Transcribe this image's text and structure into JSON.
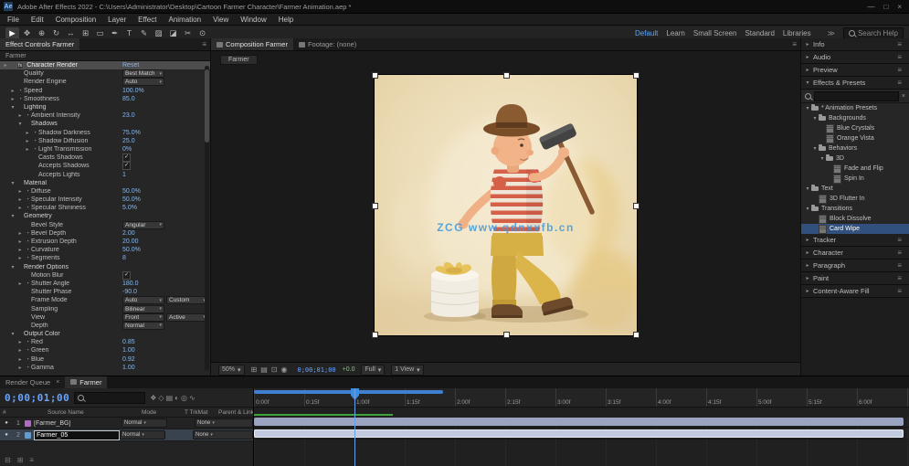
{
  "colors": {
    "accent_blue": "#5aa7ff",
    "value_blue": "#86b7ec",
    "timecode_blue": "#6aa3ff",
    "cache_green": "#3fa33c",
    "workarea_blue": "#3f80d0",
    "selection_blue": "#31507d",
    "panel_bg": "#262626",
    "viewer_bg": "#1a1a1a",
    "comp_background": "#ecdcb6",
    "watermark_blue": "#3f99dc"
  },
  "titlebar": {
    "app_badge": "Ae",
    "title": "Adobe After Effects 2022 - C:\\Users\\Administrator\\Desktop\\Cartoon Farmer Character\\Farmer Animation.aep *",
    "minimize": "—",
    "maximize": "□",
    "close": "×"
  },
  "menubar": {
    "items": [
      "File",
      "Edit",
      "Composition",
      "Layer",
      "Effect",
      "Animation",
      "View",
      "Window",
      "Help"
    ]
  },
  "toolbar": {
    "tools": [
      {
        "name": "selection-tool",
        "glyph": "▶"
      },
      {
        "name": "hand-tool",
        "glyph": "✥"
      },
      {
        "name": "zoom-tool",
        "glyph": "⊕"
      },
      {
        "name": "orbit-camera-tool",
        "glyph": "↻"
      },
      {
        "name": "pan-camera-tool",
        "glyph": "↔"
      },
      {
        "name": "pan-behind-tool",
        "glyph": "⊞"
      },
      {
        "name": "shape-tool",
        "glyph": "▭"
      },
      {
        "name": "pen-tool",
        "glyph": "✒"
      },
      {
        "name": "type-tool",
        "glyph": "T"
      },
      {
        "name": "brush-tool",
        "glyph": "✎"
      },
      {
        "name": "clone-stamp-tool",
        "glyph": "▨"
      },
      {
        "name": "eraser-tool",
        "glyph": "◪"
      },
      {
        "name": "roto-brush-tool",
        "glyph": "✂"
      },
      {
        "name": "puppet-pin-tool",
        "glyph": "⊙"
      }
    ],
    "workspaces": [
      "Default",
      "Learn",
      "Small Screen",
      "Standard",
      "Libraries"
    ],
    "active_workspace": "Default",
    "overflow": "≫",
    "search_label": "Search Help"
  },
  "effect_controls": {
    "tab_label": "Effect Controls Farmer",
    "source_label": "Farmer",
    "rows": [
      {
        "t": "header",
        "l": "Character Render",
        "v": "Reset",
        "tw": "closed",
        "sel": true,
        "i": 0
      },
      {
        "t": "select",
        "l": "Quality",
        "v": "Best Match",
        "tw": "none",
        "i": 1
      },
      {
        "t": "select",
        "l": "Render Engine",
        "v": "Auto",
        "tw": "none",
        "i": 1
      },
      {
        "t": "num",
        "l": "Speed",
        "v": "100.0%",
        "tw": "closed",
        "sw": true,
        "i": 1
      },
      {
        "t": "num",
        "l": "Smoothness",
        "v": "85.0",
        "tw": "closed",
        "sw": true,
        "i": 1
      },
      {
        "t": "group",
        "l": "Lighting",
        "tw": "open",
        "i": 1
      },
      {
        "t": "num",
        "l": "Ambient Intensity",
        "v": "23.0",
        "tw": "closed",
        "sw": true,
        "i": 2
      },
      {
        "t": "group",
        "l": "Shadows",
        "tw": "open",
        "i": 2
      },
      {
        "t": "num",
        "l": "Shadow Darkness",
        "v": "75.0%",
        "tw": "closed",
        "sw": true,
        "i": 3
      },
      {
        "t": "num",
        "l": "Shadow Diffusion",
        "v": "25.0",
        "tw": "closed",
        "sw": true,
        "i": 3
      },
      {
        "t": "num",
        "l": "Light Transmission",
        "v": "0%",
        "tw": "closed",
        "sw": true,
        "i": 3
      },
      {
        "t": "check",
        "l": "Casts Shadows",
        "chk": true,
        "tw": "none",
        "i": 3
      },
      {
        "t": "check",
        "l": "Accepts Shadows",
        "chk": true,
        "tw": "none",
        "i": 3
      },
      {
        "t": "num",
        "l": "Accepts Lights",
        "v": "1",
        "tw": "none",
        "i": 3
      },
      {
        "t": "group",
        "l": "Material",
        "tw": "open",
        "i": 1
      },
      {
        "t": "num",
        "l": "Diffuse",
        "v": "50.0%",
        "tw": "closed",
        "sw": true,
        "i": 2
      },
      {
        "t": "num",
        "l": "Specular Intensity",
        "v": "50.0%",
        "tw": "closed",
        "sw": true,
        "i": 2
      },
      {
        "t": "num",
        "l": "Specular Shininess",
        "v": "5.0%",
        "tw": "closed",
        "sw": true,
        "i": 2
      },
      {
        "t": "group",
        "l": "Geometry",
        "tw": "open",
        "i": 1
      },
      {
        "t": "select",
        "l": "Bevel Style",
        "v": "Angular",
        "tw": "none",
        "i": 2
      },
      {
        "t": "num",
        "l": "Bevel Depth",
        "v": "2.00",
        "tw": "closed",
        "sw": true,
        "i": 2
      },
      {
        "t": "num",
        "l": "Extrusion Depth",
        "v": "20.00",
        "tw": "closed",
        "sw": true,
        "i": 2
      },
      {
        "t": "num",
        "l": "Curvature",
        "v": "50.0%",
        "tw": "closed",
        "sw": true,
        "i": 2
      },
      {
        "t": "num",
        "l": "Segments",
        "v": "8",
        "tw": "closed",
        "sw": true,
        "i": 2
      },
      {
        "t": "group",
        "l": "Render Options",
        "tw": "open",
        "i": 1
      },
      {
        "t": "check",
        "l": "Motion Blur",
        "chk": true,
        "tw": "none",
        "i": 2
      },
      {
        "t": "num",
        "l": "Shutter Angle",
        "v": "180.0",
        "tw": "closed",
        "sw": true,
        "i": 2
      },
      {
        "t": "num",
        "l": "Shutter Phase",
        "v": "-90.0",
        "tw": "none",
        "i": 2
      },
      {
        "t": "select2",
        "l": "Frame Mode",
        "v": "Auto",
        "v2": "Custom",
        "tw": "none",
        "i": 2
      },
      {
        "t": "select",
        "l": "Sampling",
        "v": "Bilinear",
        "tw": "none",
        "i": 2
      },
      {
        "t": "select2",
        "l": "View",
        "v": "Front",
        "v2": "Active",
        "tw": "none",
        "i": 2
      },
      {
        "t": "select",
        "l": "Depth",
        "v": "Normal",
        "tw": "none",
        "i": 2
      },
      {
        "t": "group",
        "l": "Output Color",
        "tw": "open",
        "i": 1
      },
      {
        "t": "num",
        "l": "Red",
        "v": "0.85",
        "tw": "closed",
        "sw": true,
        "i": 2
      },
      {
        "t": "num",
        "l": "Green",
        "v": "1.00",
        "tw": "closed",
        "sw": true,
        "i": 2
      },
      {
        "t": "num",
        "l": "Blue",
        "v": "0.92",
        "tw": "closed",
        "sw": true,
        "i": 2
      },
      {
        "t": "num",
        "l": "Gamma",
        "v": "1.00",
        "tw": "closed",
        "sw": true,
        "i": 2
      }
    ]
  },
  "viewer": {
    "tabs": [
      {
        "label": "Composition Farmer",
        "active": true
      },
      {
        "label": "Footage: (none)",
        "active": false
      }
    ],
    "comp_nav": "Farmer",
    "watermark": "ZCG  www.qdnxxfb.cn",
    "statusbar": {
      "zoom": "50%",
      "timecode": "0;00;01;00",
      "exposure": "+0.0",
      "res": "Full",
      "view": "1 View",
      "icons": [
        {
          "name": "grid-and-guides-icon",
          "glyph": "⊞"
        },
        {
          "name": "rulers-icon",
          "glyph": "▤"
        },
        {
          "name": "region-of-interest-icon",
          "glyph": "⊡"
        },
        {
          "name": "channel-icon",
          "glyph": "◉"
        }
      ]
    }
  },
  "right_panel": {
    "top_panels": [
      {
        "title": "Info"
      },
      {
        "title": "Audio"
      },
      {
        "title": "Preview"
      }
    ],
    "effects_presets": {
      "title": "Effects & Presets",
      "search_value": "",
      "clear_icon": "×",
      "tree": [
        {
          "d": 0,
          "icon": "folder",
          "tw": "open",
          "label": "* Animation Presets"
        },
        {
          "d": 1,
          "icon": "folder",
          "tw": "open",
          "label": "Backgrounds"
        },
        {
          "d": 2,
          "icon": "preset",
          "tw": "none",
          "label": "Blue Crystals"
        },
        {
          "d": 2,
          "icon": "preset",
          "tw": "none",
          "label": "Orange Vista"
        },
        {
          "d": 1,
          "icon": "folder",
          "tw": "open",
          "label": "Behaviors"
        },
        {
          "d": 2,
          "icon": "folder",
          "tw": "open",
          "label": "3D"
        },
        {
          "d": 3,
          "icon": "preset",
          "tw": "none",
          "label": "Fade and Flip"
        },
        {
          "d": 3,
          "icon": "preset",
          "tw": "none",
          "label": "Spin In"
        },
        {
          "d": 0,
          "icon": "folder",
          "tw": "open",
          "label": "Text"
        },
        {
          "d": 1,
          "icon": "preset",
          "tw": "none",
          "label": "3D Flutter In"
        },
        {
          "d": 0,
          "icon": "folder",
          "tw": "open",
          "label": "Transitions"
        },
        {
          "d": 1,
          "icon": "preset",
          "tw": "none",
          "label": "Block Dissolve"
        },
        {
          "d": 1,
          "icon": "preset",
          "tw": "none",
          "label": "Card Wipe",
          "sel": true
        }
      ]
    },
    "bottom_panels": [
      {
        "title": "Tracker"
      },
      {
        "title": "Character"
      },
      {
        "title": "Paragraph"
      },
      {
        "title": "Paint"
      },
      {
        "title": "Content-Aware Fill"
      }
    ]
  },
  "timeline": {
    "tabs": [
      {
        "label": "Render Queue",
        "active": false,
        "closable": true
      },
      {
        "label": "Farmer",
        "active": true,
        "closable": false
      }
    ],
    "timecode": "0;00;01;00",
    "search_value": "",
    "toolbar_icons": [
      {
        "name": "comp-mini-flowchart-icon",
        "glyph": "❖"
      },
      {
        "name": "draft-3d-icon",
        "glyph": "◇"
      },
      {
        "name": "hide-shy-layers-icon",
        "glyph": "▤"
      },
      {
        "name": "frame-blend-icon",
        "glyph": "◐"
      },
      {
        "name": "motion-blur-icon",
        "glyph": "◎"
      },
      {
        "name": "graph-editor-icon",
        "glyph": "∿"
      }
    ],
    "columns": [
      "#",
      "Source Name",
      "Mode",
      "T TrkMat",
      "Parent & Link"
    ],
    "layers": [
      {
        "num": "1",
        "chip": "#b06cc4",
        "name": "[Farmer_BG]",
        "mode": "Normal",
        "parent": "None",
        "eye": "●",
        "editing": false,
        "selected": false
      },
      {
        "num": "2",
        "chip": "#5f9bd6",
        "name": "Farmer_05",
        "mode": "Normal",
        "parent": "None",
        "eye": "●",
        "editing": true,
        "selected": true
      }
    ],
    "ruler_labels": [
      "0:00f",
      "0:15f",
      "1:00f",
      "1:15f",
      "2:00f",
      "2:15f",
      "3:00f",
      "3:15f",
      "4:00f",
      "4:15f",
      "5:00f",
      "5:15f",
      "6:00f"
    ],
    "footer_icons": [
      {
        "name": "expand-layer-switches-icon",
        "glyph": "⊟"
      },
      {
        "name": "expand-transfer-controls-icon",
        "glyph": "⊞"
      },
      {
        "name": "expand-in-out-icon",
        "glyph": "≡"
      }
    ]
  }
}
